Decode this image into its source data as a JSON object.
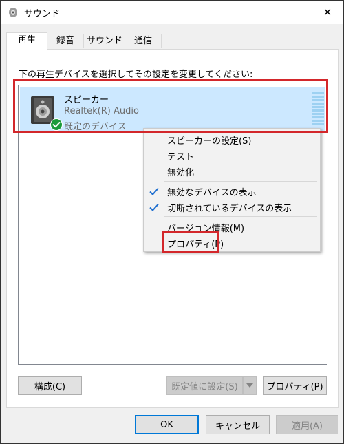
{
  "window": {
    "title": "サウンド",
    "close_glyph": "✕"
  },
  "tabs": [
    {
      "label": "再生",
      "active": true
    },
    {
      "label": "録音",
      "active": false
    },
    {
      "label": "サウンド",
      "active": false
    },
    {
      "label": "通信",
      "active": false
    }
  ],
  "playback": {
    "instruction": "下の再生デバイスを選択してその設定を変更してください:",
    "device": {
      "name": "スピーカー",
      "driver": "Realtek(R) Audio",
      "status": "既定のデバイス",
      "icon": "speaker-icon",
      "status_icon": "check-badge-icon"
    }
  },
  "context_menu": {
    "items": [
      {
        "label": "スピーカーの設定(S)",
        "checked": false
      },
      {
        "label": "テスト",
        "checked": false
      },
      {
        "label": "無効化",
        "checked": false
      },
      {
        "label": "無効なデバイスの表示",
        "checked": true
      },
      {
        "label": "切断されているデバイスの表示",
        "checked": true
      },
      {
        "label": "バージョン情報(M)",
        "checked": false
      },
      {
        "label": "プロパティ(P)",
        "checked": false
      }
    ]
  },
  "buttons": {
    "configure": "構成(C)",
    "set_default": "既定値に設定(S)",
    "properties": "プロパティ(P)",
    "ok": "OK",
    "cancel": "キャンセル",
    "apply": "適用(A)"
  },
  "colors": {
    "selection": "#cce8ff",
    "highlight_box": "#d3272b",
    "check_green": "#1a9b3a",
    "check_blue": "#1f6fd0"
  }
}
